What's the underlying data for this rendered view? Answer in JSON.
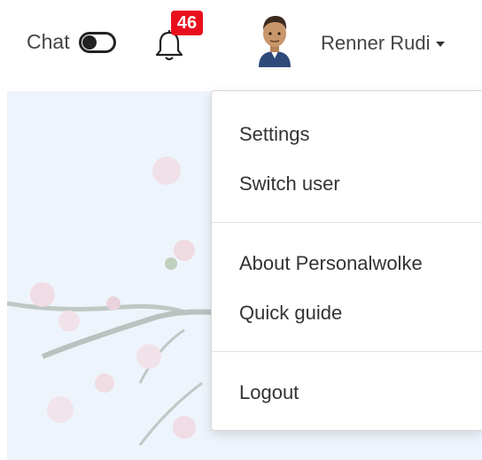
{
  "topbar": {
    "chat_label": "Chat",
    "chat_enabled": true,
    "notifications_count": "46",
    "user_name": "Renner Rudi"
  },
  "colors": {
    "badge": "#e8101d",
    "background_tint": "#eef4fb"
  },
  "icons": {
    "toggle": "toggle-icon",
    "notifications": "bell-icon",
    "avatar": "avatar-icon",
    "caret": "caret-down-icon"
  },
  "menu": {
    "settings": "Settings",
    "switch_user": "Switch user",
    "about": "About Personalwolke",
    "quick_guide": "Quick guide",
    "logout": "Logout"
  }
}
